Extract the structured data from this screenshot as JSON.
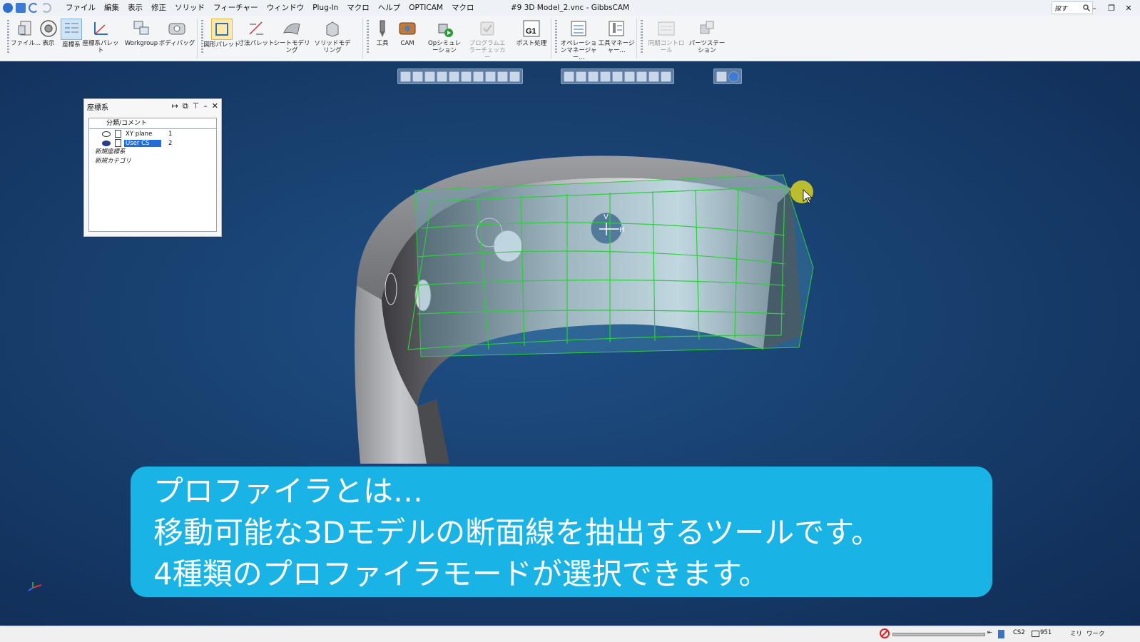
{
  "window": {
    "title": "#9 3D Model_2.vnc - GibbsCAM",
    "search_placeholder": "探す",
    "controls": [
      "minimize",
      "restore",
      "close"
    ]
  },
  "menu": [
    "ファイル",
    "編集",
    "表示",
    "修正",
    "ソリッド",
    "フィーチャー",
    "ウィンドウ",
    "Plug-In",
    "マクロ",
    "ヘルプ",
    "OPTICAM",
    "マクロ"
  ],
  "ribbon": {
    "tools": [
      {
        "label": "ファイル..."
      },
      {
        "label": "表示"
      },
      {
        "label": "座標系"
      },
      {
        "label": "座標系パレット"
      },
      {
        "label": "Workgroup"
      },
      {
        "label": "ボディバッグ"
      },
      {
        "label": "図形パレット"
      },
      {
        "label": "寸法パレット"
      },
      {
        "label": "シートモデリング"
      },
      {
        "label": "ソリッドモデリング"
      },
      {
        "label": "工具"
      },
      {
        "label": "CAM"
      },
      {
        "label": "Opシミュレーション"
      },
      {
        "label": "プログラムエラーチェッカー"
      },
      {
        "label": "ポスト処理"
      },
      {
        "label": "オペレーションマネージャー..."
      },
      {
        "label": "工具マネージャー..."
      },
      {
        "label": "同期コントロール"
      },
      {
        "label": "パーツステーション"
      }
    ]
  },
  "cs_panel": {
    "title": "座標系",
    "column_header": "分類/コメント",
    "rows": [
      {
        "name": "XY plane",
        "num": "1"
      },
      {
        "name": "User CS",
        "num": "2"
      }
    ],
    "items": [
      "新規座標系",
      "新規カテゴリ"
    ]
  },
  "model_labels": {
    "v": "V",
    "h": "H"
  },
  "caption": {
    "line1": "プロファイラとは…",
    "line2": "移動可能な3Dモデルの断面線を抽出するツールです。",
    "line3": "4種類のプロファイラモードが選択できます。"
  },
  "status": {
    "cs": "CS2",
    "tool_count": "951",
    "units": "ミリ",
    "mode": "ワーク"
  },
  "colors": {
    "viewport": "#18406f",
    "caption_bg": "#1ab3e6",
    "selection": "#1e6fd9",
    "profiler_grid": "#2bcf3a"
  }
}
